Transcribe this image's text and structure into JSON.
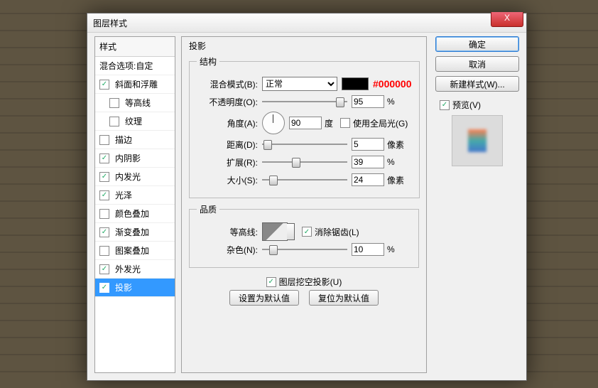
{
  "window": {
    "title": "图层样式"
  },
  "stylelist": {
    "header": "样式",
    "blend_options": "混合选项:自定",
    "items": [
      {
        "label": "斜面和浮雕",
        "checked": true,
        "indent": false
      },
      {
        "label": "等高线",
        "checked": false,
        "indent": true
      },
      {
        "label": "纹理",
        "checked": false,
        "indent": true
      },
      {
        "label": "描边",
        "checked": false,
        "indent": false
      },
      {
        "label": "内阴影",
        "checked": true,
        "indent": false
      },
      {
        "label": "内发光",
        "checked": true,
        "indent": false
      },
      {
        "label": "光泽",
        "checked": true,
        "indent": false
      },
      {
        "label": "颜色叠加",
        "checked": false,
        "indent": false
      },
      {
        "label": "渐变叠加",
        "checked": true,
        "indent": false
      },
      {
        "label": "图案叠加",
        "checked": false,
        "indent": false
      },
      {
        "label": "外发光",
        "checked": true,
        "indent": false
      },
      {
        "label": "投影",
        "checked": true,
        "indent": false,
        "selected": true
      }
    ]
  },
  "panel": {
    "title": "投影",
    "structure_legend": "结构",
    "quality_legend": "品质",
    "blend_mode_label": "混合模式(B):",
    "blend_mode_value": "正常",
    "color_hex": "#000000",
    "opacity_label": "不透明度(O):",
    "opacity_value": "95",
    "opacity_unit": "%",
    "angle_label": "角度(A):",
    "angle_value": "90",
    "angle_unit": "度",
    "global_light_label": "使用全局光(G)",
    "global_light_checked": false,
    "distance_label": "距离(D):",
    "distance_value": "5",
    "distance_unit": "像素",
    "spread_label": "扩展(R):",
    "spread_value": "39",
    "spread_unit": "%",
    "size_label": "大小(S):",
    "size_value": "24",
    "size_unit": "像素",
    "contour_label": "等高线:",
    "antialiased_label": "消除锯齿(L)",
    "antialiased_checked": true,
    "noise_label": "杂色(N):",
    "noise_value": "10",
    "noise_unit": "%",
    "knockout_label": "图层挖空投影(U)",
    "knockout_checked": true,
    "set_default_btn": "设置为默认值",
    "reset_default_btn": "复位为默认值"
  },
  "right": {
    "ok": "确定",
    "cancel": "取消",
    "new_style": "新建样式(W)...",
    "preview_label": "预览(V)",
    "preview_checked": true
  }
}
